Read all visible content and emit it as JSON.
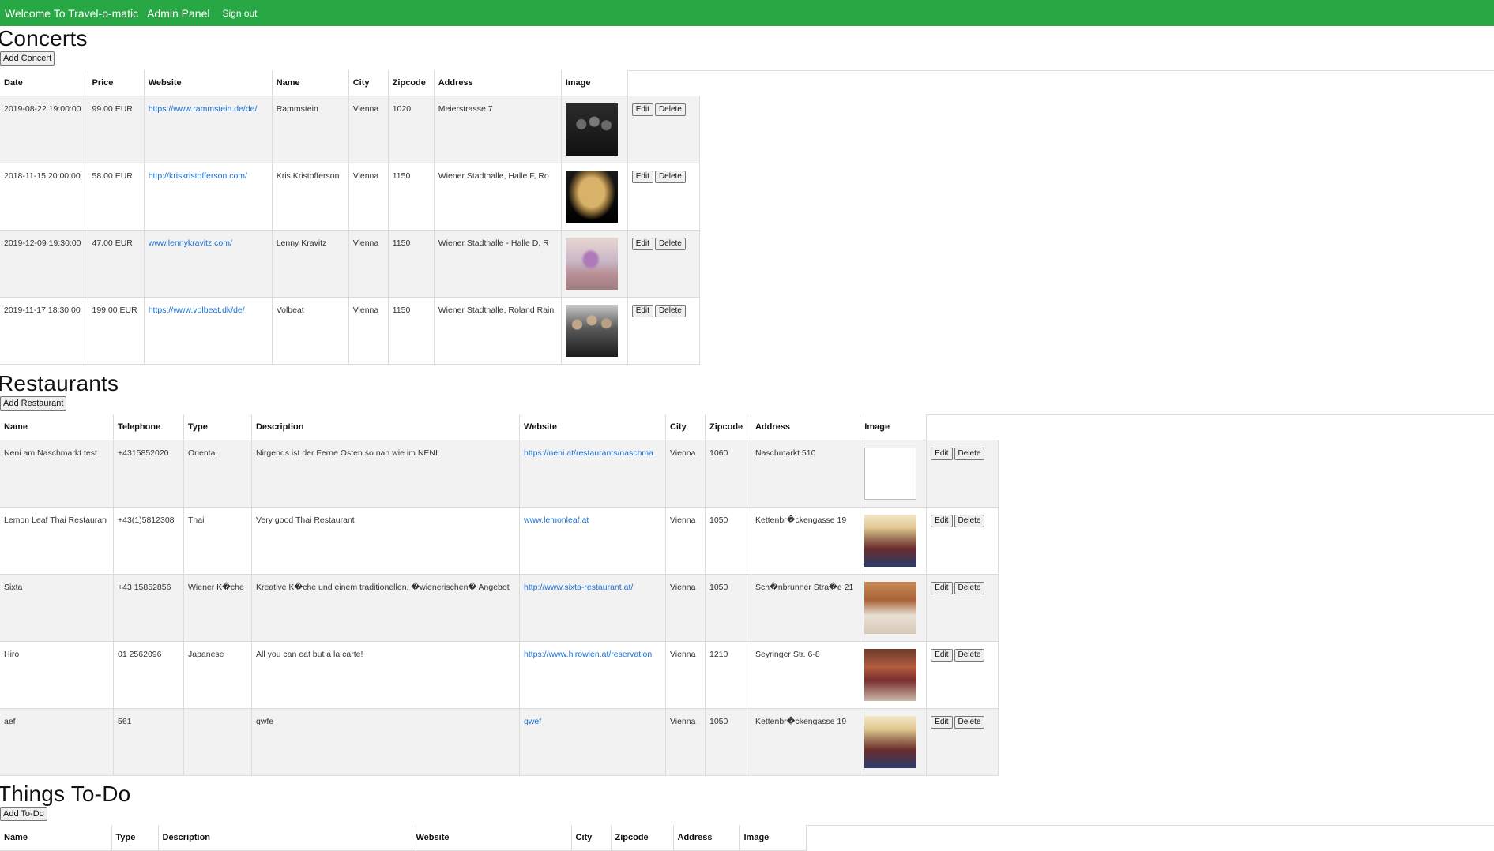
{
  "topbar": {
    "brand": "Welcome To Travel-o-matic",
    "admin": "Admin Panel",
    "signout": "Sign out"
  },
  "concerts": {
    "title": "Concerts",
    "add_label": "Add Concert",
    "columns": [
      "Date",
      "Price",
      "Website",
      "Name",
      "City",
      "Zipcode",
      "Address",
      "Image"
    ],
    "rows": [
      {
        "date": "2019-08-22 19:00:00",
        "price": "99.00 EUR",
        "website": "https://www.rammstein.de/de/",
        "name": "Rammstein",
        "city": "Vienna",
        "zip": "1020",
        "address": "Meierstrasse 7",
        "image": "band-photo-dark"
      },
      {
        "date": "2018-11-15 20:00:00",
        "price": "58.00 EUR",
        "website": "http://kriskristofferson.com/",
        "name": "Kris Kristofferson",
        "city": "Vienna",
        "zip": "1150",
        "address": "Wiener Stadthalle, Halle F, Ro",
        "image": "portrait-photo"
      },
      {
        "date": "2019-12-09 19:30:00",
        "price": "47.00 EUR",
        "website": "www.lennykravitz.com/",
        "name": "Lenny Kravitz",
        "city": "Vienna",
        "zip": "1150",
        "address": "Wiener Stadthalle - Halle D, R",
        "image": "beach-photo"
      },
      {
        "date": "2019-11-17 18:30:00",
        "price": "199.00 EUR",
        "website": "https://www.volbeat.dk/de/",
        "name": "Volbeat",
        "city": "Vienna",
        "zip": "1150",
        "address": "Wiener Stadthalle, Roland Rain",
        "image": "band-photo"
      }
    ]
  },
  "restaurants": {
    "title": "Restaurants",
    "add_label": "Add Restaurant",
    "columns": [
      "Name",
      "Telephone",
      "Type",
      "Description",
      "Website",
      "City",
      "Zipcode",
      "Address",
      "Image"
    ],
    "rows": [
      {
        "name": "Neni am Naschmarkt test",
        "tel": "+4315852020",
        "type": "Oriental",
        "desc": "Nirgends ist der Ferne Osten so nah wie im NENI",
        "website": "https://neni.at/restaurants/naschma",
        "city": "Vienna",
        "zip": "1060",
        "address": "Naschmarkt 510",
        "image": "broken"
      },
      {
        "name": "Lemon Leaf Thai Restauran",
        "tel": "+43(1)5812308",
        "type": "Thai",
        "desc": "Very good Thai Restaurant",
        "website": "www.lemonleaf.at",
        "city": "Vienna",
        "zip": "1050",
        "address": "Kettenbr�ckengasse 19",
        "image": "restaurant-photo"
      },
      {
        "name": "Sixta",
        "tel": "+43 15852856",
        "type": "Wiener K�che",
        "desc": "Kreative K�che und einem traditionellen, �wienerischen� Angebot",
        "website": "http://www.sixta-restaurant.at/",
        "city": "Vienna",
        "zip": "1050",
        "address": "Sch�nbrunner Stra�e 21",
        "image": "restaurant-photo-warm"
      },
      {
        "name": "Hiro",
        "tel": "01 2562096",
        "type": "Japanese",
        "desc": "All you can eat but a la carte!",
        "website": "https://www.hirowien.at/reservation",
        "city": "Vienna",
        "zip": "1210",
        "address": "Seyringer Str. 6-8",
        "image": "restaurant-photo-red"
      },
      {
        "name": "aef",
        "tel": "561",
        "type": "",
        "desc": "qwfe",
        "website": "qwef",
        "city": "Vienna",
        "zip": "1050",
        "address": "Kettenbr�ckengasse 19",
        "image": "restaurant-photo"
      }
    ]
  },
  "todos": {
    "title": "Things To-Do",
    "add_label": "Add To-Do",
    "columns": [
      "Name",
      "Type",
      "Description",
      "Website",
      "City",
      "Zipcode",
      "Address",
      "Image"
    ]
  },
  "actions": {
    "edit": "Edit",
    "delete": "Delete"
  }
}
